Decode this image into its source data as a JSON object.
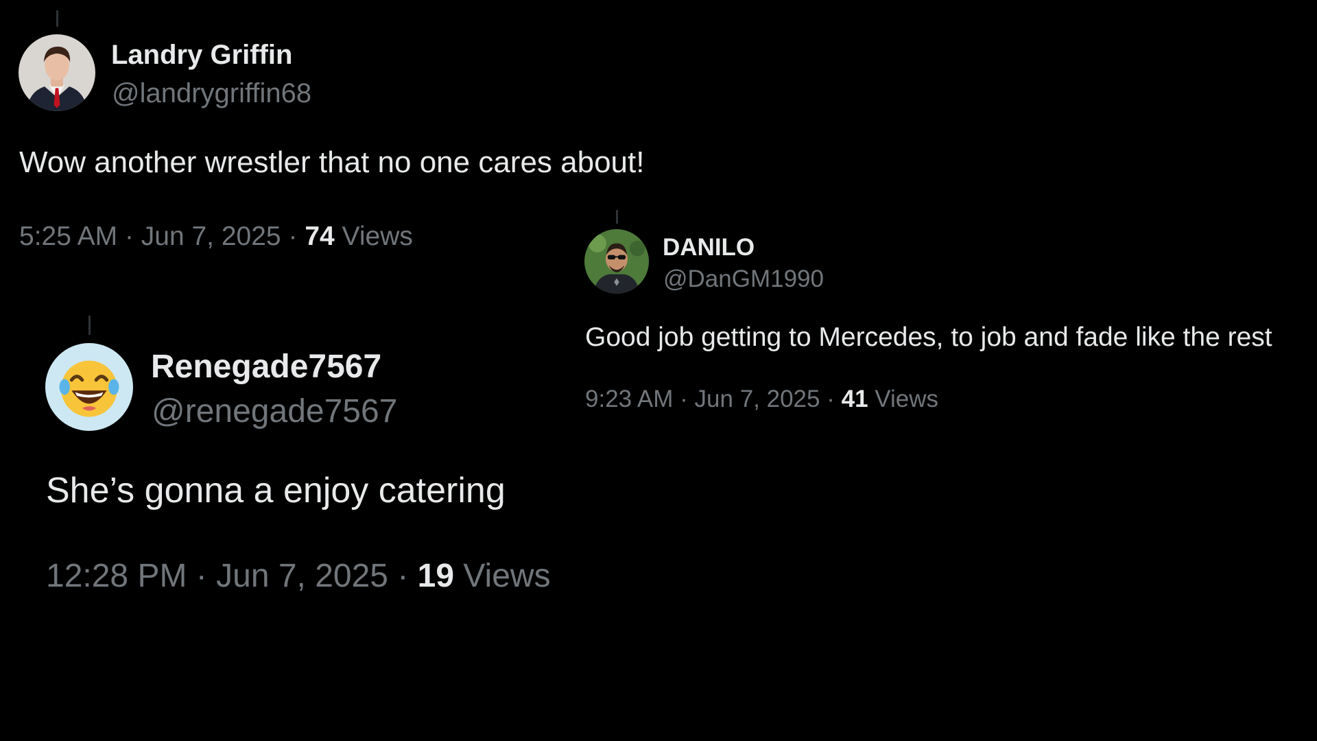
{
  "tweets": [
    {
      "name": "Landry Griffin",
      "handle": "@landrygriffin68",
      "text": "Wow another wrestler that no one cares about!",
      "time": "5:25 AM",
      "date": "Jun 7, 2025",
      "views_count": "74",
      "views_label": "Views",
      "avatar_icon": "man-in-suit-avatar"
    },
    {
      "name": "DANILO",
      "handle": "@DanGM1990",
      "text": "Good job getting to Mercedes, to job and fade like the rest",
      "time": "9:23 AM",
      "date": "Jun 7, 2025",
      "views_count": "41",
      "views_label": "Views",
      "avatar_icon": "man-with-sunglasses-avatar"
    },
    {
      "name": "Renegade7567",
      "handle": "@renegade7567",
      "text": "She’s gonna a enjoy catering",
      "time": "12:28 PM",
      "date": "Jun 7, 2025",
      "views_count": "19",
      "views_label": "Views",
      "avatar_icon": "laughing-emoji-avatar"
    }
  ],
  "separator": "·",
  "colors": {
    "background": "#000000",
    "primary_text": "#e7e9ea",
    "secondary_text": "#71767b",
    "thread_line": "#2f3336"
  }
}
